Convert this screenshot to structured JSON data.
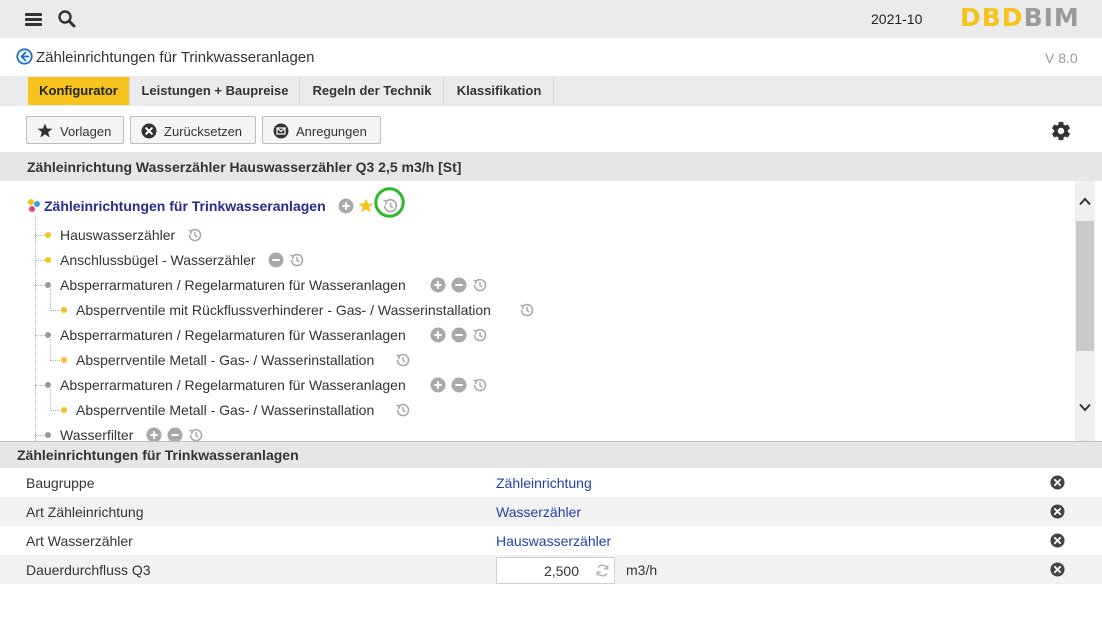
{
  "topbar": {
    "menu_icon": "hamburger-menu-icon",
    "search_icon": "search-icon",
    "date": "2021-10",
    "logo_part1": "DBD",
    "logo_part2": "BIM"
  },
  "titlebar": {
    "back_icon": "arrow-left-circle-icon",
    "title": "Zähleinrichtungen für Trinkwasseranlagen",
    "version": "V 8.0"
  },
  "tabs": [
    {
      "label": "Konfigurator",
      "active": true
    },
    {
      "label": "Leistungen + Baupreise",
      "active": false
    },
    {
      "label": "Regeln der Technik",
      "active": false
    },
    {
      "label": "Klassifikation",
      "active": false
    }
  ],
  "toolbar": {
    "vorlagen": "Vorlagen",
    "zuruecksetzen": "Zurücksetzen",
    "anregungen": "Anregungen",
    "settings_icon": "gear-icon"
  },
  "product_header": "Zähleinrichtung Wasserzähler Hauswasserzähler Q3 2,5 m3/h [St]",
  "tree": {
    "root": "Zähleinrichtungen für Trinkwasseranlagen",
    "nodes": [
      {
        "label": "Hauswasserzähler"
      },
      {
        "label": "Anschlussbügel - Wasserzähler"
      },
      {
        "label": "Absperrarmaturen / Regelarmaturen für Wasseranlagen"
      },
      {
        "label": "Absperrventile mit Rückflussverhinderer - Gas- / Wasserinstallation"
      },
      {
        "label": "Absperrarmaturen / Regelarmaturen für Wasseranlagen"
      },
      {
        "label": "Absperrventile Metall - Gas- / Wasserinstallation"
      },
      {
        "label": "Absperrarmaturen / Regelarmaturen für Wasseranlagen"
      },
      {
        "label": "Absperrventile Metall - Gas- / Wasserinstallation"
      },
      {
        "label": "Wasserfilter"
      }
    ]
  },
  "properties": {
    "header": "Zähleinrichtungen für Trinkwasseranlagen",
    "rows": [
      {
        "label": "Baugruppe",
        "value": "Zähleinrichtung"
      },
      {
        "label": "Art Zähleinrichtung",
        "value": "Wasserzähler"
      },
      {
        "label": "Art Wasserzähler",
        "value": "Hauswasserzähler"
      },
      {
        "label": "Dauerdurchfluss Q3",
        "value": "2,500",
        "unit": "m3/h"
      }
    ]
  },
  "colors": {
    "accent": "#f6c31c",
    "link": "#1f44a6",
    "highlight_ring": "#2db82d"
  }
}
